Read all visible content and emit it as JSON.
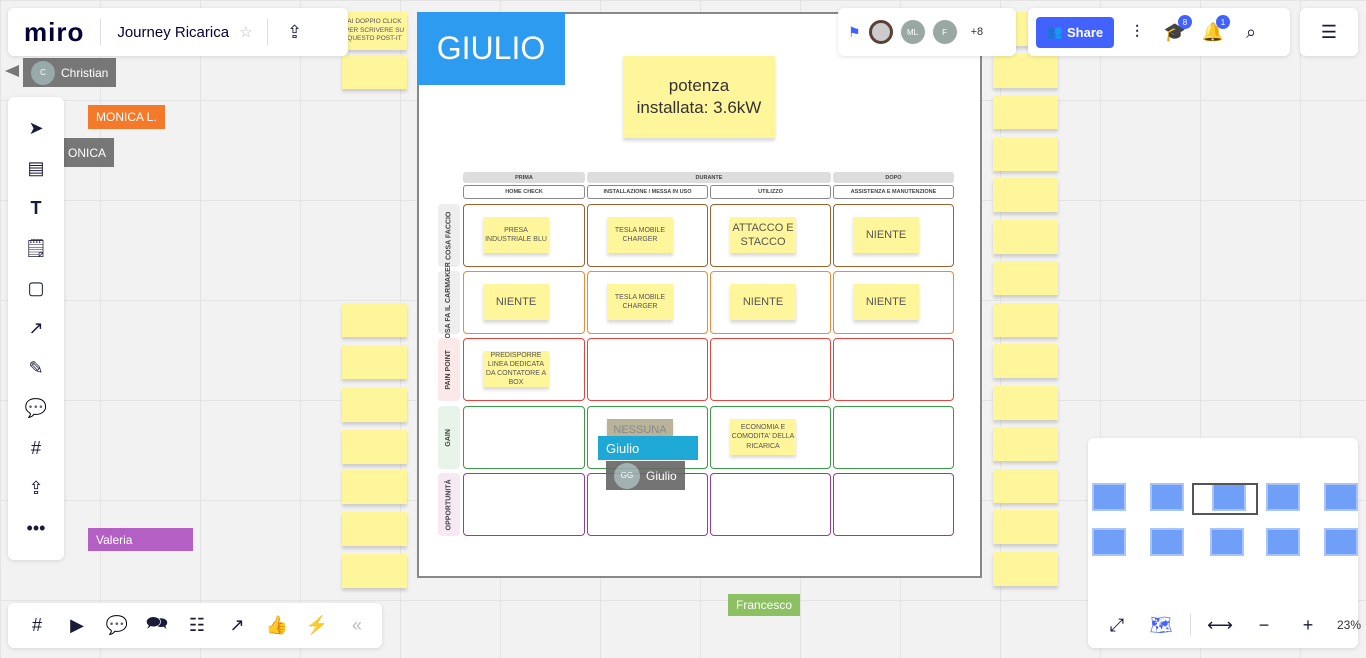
{
  "header": {
    "logo": "miro",
    "board_title": "Journey Ricarica",
    "star_icon": "star-icon",
    "export_icon": "upload-icon"
  },
  "collab": {
    "avatars": [
      "ML",
      "F"
    ],
    "more": "+8",
    "share_label": "Share",
    "education_badge": "8",
    "notifications_badge": "1"
  },
  "cursors": {
    "christian": "Christian",
    "christian_initial": "C",
    "monica_l": "MONICA L.",
    "monica": "ONICA",
    "valeria": "Valeria",
    "francesco": "Francesco",
    "giulio_tag": "Giulio",
    "giulio_name": "Giulio",
    "giulio_initials": "GG"
  },
  "board": {
    "frame_title": "GIULIO",
    "power_note": "potenza installata: 3.6kW",
    "top_left_note": "AI DOPPIO CLICK PER SCRIVERE SU QUESTO POST-IT",
    "phases": [
      "PRIMA",
      "DURANTE",
      "DOPO"
    ],
    "stages": [
      "HOME CHECK",
      "INSTALLAZIONE / MESSA IN USO",
      "UTILIZZO",
      "ASSISTENZA E MANUTENZIONE"
    ],
    "rows": [
      {
        "label": "COSA FACCIO",
        "color": "#a0622d",
        "notes": [
          "PRESA INDUSTRIALE BLU",
          "TESLA MOBILE CHARGER",
          "ATTACCO E STACCO",
          "NIENTE"
        ]
      },
      {
        "label": "COSA FA IL CARMAKER",
        "color": "#f08a30",
        "notes": [
          "NIENTE",
          "TESLA MOBILE CHARGER",
          "NIENTE",
          "NIENTE"
        ]
      },
      {
        "label": "PAIN POINT",
        "color": "#e8433a",
        "notes": [
          "PREDISPORRE LINEA DEDICATA DA CONTATORE A BOX",
          "",
          "",
          ""
        ]
      },
      {
        "label": "GAIN",
        "color": "#3a9a45",
        "notes": [
          "",
          "NESSUNA SPESA",
          "ECONOMIA E COMODITA' DELLA RICARICA",
          ""
        ]
      },
      {
        "label": "OPPORTUNITÀ",
        "color": "#9c3a9c",
        "notes": [
          "",
          "",
          "",
          ""
        ]
      }
    ]
  },
  "zoom": {
    "level": "23%"
  },
  "colors": {
    "accent": "#4262ff",
    "frame_title_bg": "#2d9bf0",
    "sticky": "#fff59b"
  }
}
